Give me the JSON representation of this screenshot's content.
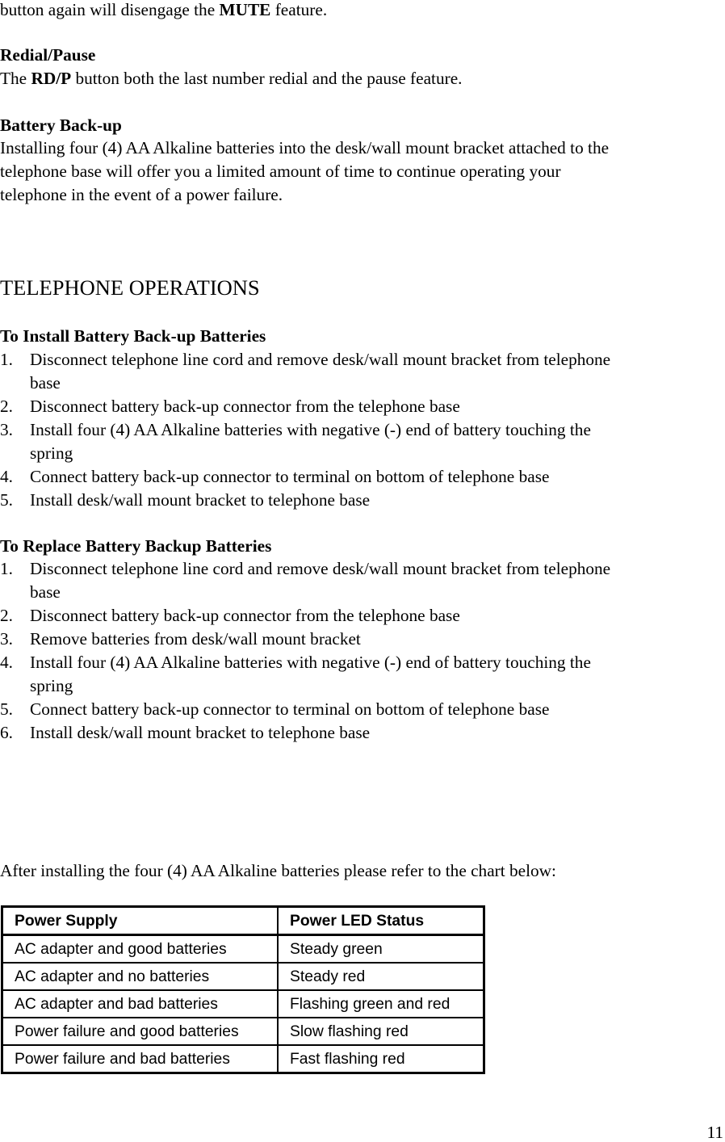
{
  "intro": {
    "line_prefix": "button again will disengage the ",
    "line_bold": "MUTE",
    "line_suffix": " feature."
  },
  "redial": {
    "heading": "Redial/Pause",
    "text_prefix": "The ",
    "text_bold": "RD/P",
    "text_suffix": " button both the last number redial and the pause feature."
  },
  "battery_backup": {
    "heading": "Battery Back-up",
    "lines": [
      "Installing four (4) AA Alkaline batteries into the desk/wall mount bracket attached to the",
      "telephone base will offer you a limited amount of time to continue operating your",
      "telephone in the event of a power failure."
    ]
  },
  "section_title": "TELEPHONE OPERATIONS",
  "install": {
    "heading": "To Install Battery Back-up Batteries",
    "steps": [
      {
        "num": "1.",
        "lines": [
          "Disconnect telephone line cord and remove desk/wall mount bracket from telephone",
          "base"
        ]
      },
      {
        "num": "2.",
        "lines": [
          "Disconnect battery back-up connector from the telephone base"
        ]
      },
      {
        "num": "3.",
        "lines": [
          "Install four (4) AA Alkaline batteries with negative (-) end of battery touching the",
          "spring"
        ]
      },
      {
        "num": "4.",
        "lines": [
          "Connect battery back-up connector to terminal on bottom of telephone base"
        ]
      },
      {
        "num": "5.",
        "lines": [
          "Install desk/wall mount bracket to telephone base"
        ]
      }
    ]
  },
  "replace": {
    "heading": "To Replace Battery Backup Batteries",
    "steps": [
      {
        "num": "1.",
        "lines": [
          "Disconnect telephone line cord and remove desk/wall mount bracket from telephone",
          "base"
        ]
      },
      {
        "num": "2.",
        "lines": [
          "Disconnect battery back-up connector from the telephone base"
        ]
      },
      {
        "num": "3.",
        "lines": [
          "Remove batteries from desk/wall mount bracket"
        ]
      },
      {
        "num": "4.",
        "lines": [
          "Install four (4) AA Alkaline batteries with negative (-) end of battery touching the",
          "spring"
        ]
      },
      {
        "num": "5.",
        "lines": [
          "Connect battery back-up connector to terminal on bottom of telephone base"
        ]
      },
      {
        "num": "6.",
        "lines": [
          "Install desk/wall mount bracket to telephone base"
        ]
      }
    ]
  },
  "chart_intro": "After installing the four (4) AA Alkaline batteries please refer to the chart below:",
  "led_table": {
    "headers": [
      "Power Supply",
      "Power LED Status"
    ],
    "rows": [
      [
        "AC adapter and good batteries",
        "Steady green"
      ],
      [
        "AC adapter and no batteries",
        "Steady red"
      ],
      [
        "AC adapter and bad batteries",
        "Flashing green and red"
      ],
      [
        "Power failure and good batteries",
        "Slow flashing red"
      ],
      [
        "Power failure and bad batteries",
        "Fast flashing red"
      ]
    ]
  },
  "page_number": "11"
}
